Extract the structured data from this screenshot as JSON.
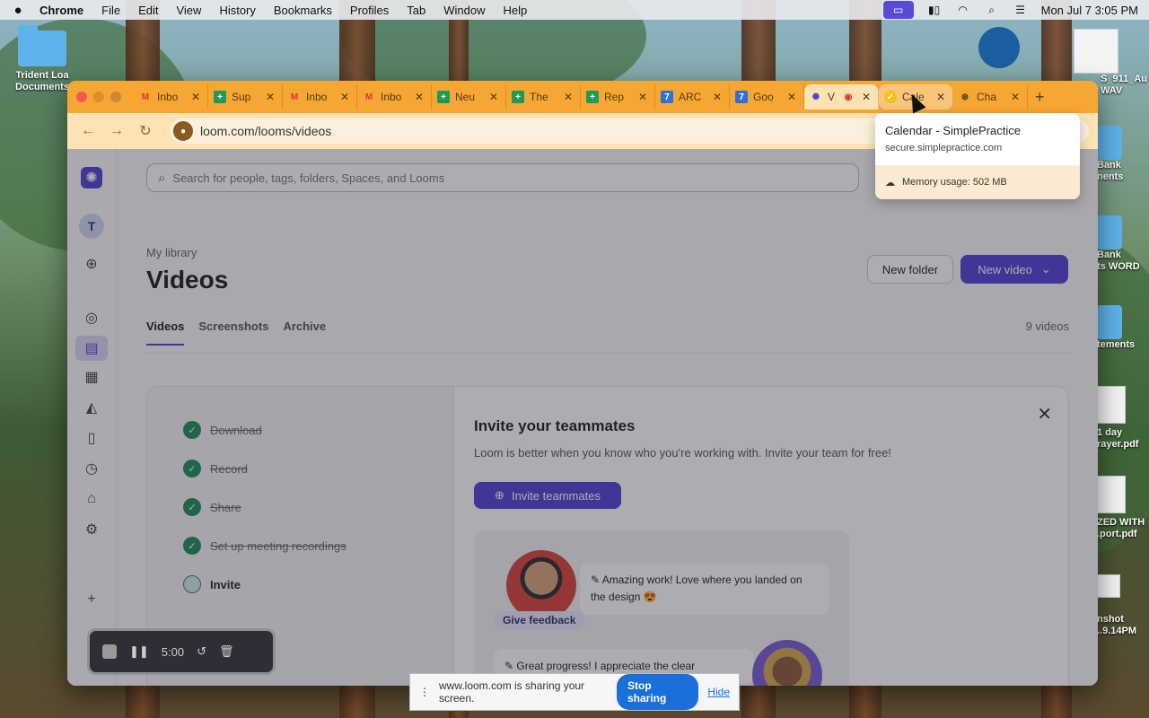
{
  "menubar": {
    "app_name": "Chrome",
    "items": [
      "File",
      "Edit",
      "View",
      "History",
      "Bookmarks",
      "Profiles",
      "Tab",
      "Window",
      "Help"
    ],
    "clock": "Mon Jul 7  3:05 PM"
  },
  "desktop": {
    "icons": [
      {
        "label": "Trident Loa\nDocuments"
      },
      {
        "label": "S_911_Au\nWAV"
      },
      {
        "label": "Bank\nnents"
      },
      {
        "label": "Bank\nts WORD"
      },
      {
        "label": "tements"
      },
      {
        "label": "1 day\nrayer.pdf"
      },
      {
        "label": "ZED WITH\n.port.pdf"
      },
      {
        "label": "nshot\n..9.14PM"
      }
    ]
  },
  "browser": {
    "tabs": [
      {
        "label": "Inbo",
        "icon": "gmail-icon"
      },
      {
        "label": "Sup",
        "icon": "sheets-icon"
      },
      {
        "label": "Inbo",
        "icon": "gmail-icon"
      },
      {
        "label": "Inbo",
        "icon": "gmail-icon"
      },
      {
        "label": "Neu",
        "icon": "sheets-icon"
      },
      {
        "label": "The",
        "icon": "sheets-icon"
      },
      {
        "label": "Rep",
        "icon": "sheets-icon"
      },
      {
        "label": "ARC",
        "icon": "calendar-icon"
      },
      {
        "label": "Goo",
        "icon": "calendar-icon"
      },
      {
        "label": "V",
        "icon": "loom-icon"
      },
      {
        "label": "Cale",
        "icon": "simplepractice-icon"
      },
      {
        "label": "Cha",
        "icon": "chatgpt-icon"
      }
    ],
    "url": "loom.com/looms/videos"
  },
  "tooltip": {
    "title": "Calendar - SimplePractice",
    "url": "secure.simplepractice.com",
    "memory": "Memory usage: 502 MB"
  },
  "loom": {
    "search_placeholder": "Search for people, tags, folders, Spaces, and Looms",
    "avatar_initial": "T",
    "library_label": "My library",
    "page_title": "Videos",
    "new_folder": "New folder",
    "new_video": "New video",
    "tabs": [
      "Videos",
      "Screenshots",
      "Archive"
    ],
    "video_count": "9 videos",
    "checklist": [
      {
        "label": "Download",
        "done": true
      },
      {
        "label": "Record",
        "done": true
      },
      {
        "label": "Share",
        "done": true
      },
      {
        "label": "Set up meeting recordings",
        "done": true
      },
      {
        "label": "Invite",
        "done": false
      }
    ],
    "invite": {
      "title": "Invite your teammates",
      "subtitle": "Loom is better when you know who you're working with. Invite your team for free!",
      "button": "Invite teammates",
      "comment_1": "Amazing work! Love where you landed on the design 😍",
      "feedback_tag": "Give feedback",
      "comment_2": "Great progress! I appreciate the clear"
    },
    "recorder_time": "5:00",
    "help": "?"
  },
  "share_bar": {
    "message": "www.loom.com is sharing your screen.",
    "stop": "Stop sharing",
    "hide": "Hide"
  },
  "colors": {
    "accent": "#4f3fd6",
    "tabstrip": "#f6a733",
    "toolbar": "#fde3b3"
  }
}
